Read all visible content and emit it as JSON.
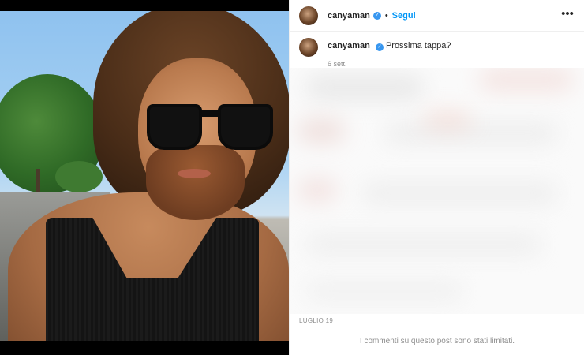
{
  "post": {
    "username": "canyaman",
    "dot": "•",
    "follow_label": "Segui",
    "more_label": "•••",
    "caption": "Prossima tappa?",
    "caption_time": "6 sett.",
    "date": "LUGLIO 19",
    "comments_limited": "I commenti su questo post sono stati limitati."
  },
  "icons": {
    "verified": "verified-badge-icon",
    "more": "more-options-icon"
  },
  "colors": {
    "follow": "#0095f6",
    "verified": "#3897f0",
    "muted": "#8e8e8e"
  }
}
